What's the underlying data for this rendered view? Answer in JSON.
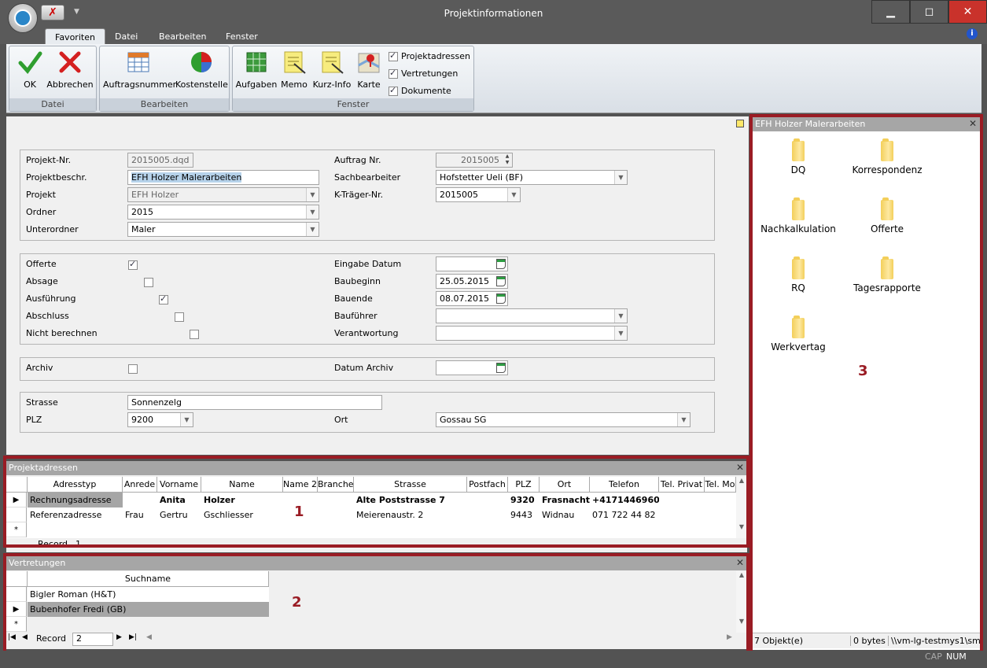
{
  "window": {
    "title": "Projektinformationen",
    "minimize": "▁",
    "maximize": "◻",
    "close": "✕"
  },
  "qat": {
    "cancel_glyph": "✗",
    "dropdown_glyph": "▼"
  },
  "ribbon": {
    "tabs": [
      "Favoriten",
      "Datei",
      "Bearbeiten",
      "Fenster"
    ],
    "active_tab": "Favoriten",
    "groups": {
      "datei": {
        "label": "Datei",
        "ok": "OK",
        "abbrechen": "Abbrechen"
      },
      "bearbeiten": {
        "label": "Bearbeiten",
        "auftragsnummer": "Auftragsnummer",
        "kostenstelle": "Kostenstelle"
      },
      "fenster": {
        "label": "Fenster",
        "aufgaben": "Aufgaben",
        "memo": "Memo",
        "kurzinfo": "Kurz-Info",
        "karte": "Karte",
        "checks": [
          {
            "label": "Projektadressen",
            "checked": true
          },
          {
            "label": "Vertretungen",
            "checked": true
          },
          {
            "label": "Dokumente",
            "checked": true
          }
        ]
      }
    }
  },
  "form": {
    "projekt_nr": {
      "label": "Projekt-Nr.",
      "value": "2015005.dqd"
    },
    "projektbeschr": {
      "label": "Projektbeschr.",
      "value": "EFH Holzer Malerarbeiten"
    },
    "projekt": {
      "label": "Projekt",
      "value": "EFH Holzer"
    },
    "ordner": {
      "label": "Ordner",
      "value": "2015"
    },
    "unterordner": {
      "label": "Unterordner",
      "value": "Maler"
    },
    "auftrag_nr": {
      "label": "Auftrag Nr.",
      "value": "2015005"
    },
    "sachbearbeiter": {
      "label": "Sachbearbeiter",
      "value": "Hofstetter Ueli (BF)"
    },
    "ktraeger": {
      "label": "K-Träger-Nr.",
      "value": "2015005"
    },
    "offerte": {
      "label": "Offerte",
      "checked": true
    },
    "absage": {
      "label": "Absage",
      "checked": false
    },
    "ausfuehrung": {
      "label": "Ausführung",
      "checked": true
    },
    "abschluss": {
      "label": "Abschluss",
      "checked": false
    },
    "nicht_berechnen": {
      "label": "Nicht berechnen",
      "checked": false
    },
    "eingabe_datum": {
      "label": "Eingabe Datum",
      "value": ""
    },
    "baubeginn": {
      "label": "Baubeginn",
      "value": "25.05.2015"
    },
    "bauende": {
      "label": "Bauende",
      "value": "08.07.2015"
    },
    "baufuehrer": {
      "label": "Bauführer",
      "value": ""
    },
    "verantwortung": {
      "label": "Verantwortung",
      "value": ""
    },
    "archiv": {
      "label": "Archiv",
      "checked": false
    },
    "datum_archiv": {
      "label": "Datum Archiv",
      "value": ""
    },
    "strasse": {
      "label": "Strasse",
      "value": "Sonnenzelg"
    },
    "plz": {
      "label": "PLZ",
      "value": "9200"
    },
    "ort": {
      "label": "Ort",
      "value": "Gossau SG"
    }
  },
  "projektadressen": {
    "title": "Projektadressen",
    "columns": [
      "Adresstyp",
      "Anrede",
      "Vorname",
      "Name",
      "Name 2",
      "Branche",
      "Strasse",
      "Postfach",
      "PLZ",
      "Ort",
      "Telefon",
      "Tel. Privat",
      "Tel. Mo"
    ],
    "rows": [
      {
        "adresstyp": "Rechnungsadresse",
        "anrede": "",
        "vorname": "Anita",
        "name": "Holzer",
        "name2": "",
        "branche": "",
        "strasse": "Alte Poststrasse 7",
        "postfach": "",
        "plz": "9320",
        "ort": "Frasnacht",
        "telefon": "+4171446960"
      },
      {
        "adresstyp": "Referenzadresse",
        "anrede": "Frau",
        "vorname": "Gertru",
        "name": "Gschliesser",
        "name2": "",
        "branche": "",
        "strasse": "Meierenaustr. 2",
        "postfach": "",
        "plz": "9443",
        "ort": "Widnau",
        "telefon": "071 722 44 82"
      }
    ],
    "new_row_marker": "*",
    "record_label": "Record",
    "record_value": "1",
    "annotation": "1"
  },
  "vertretungen": {
    "title": "Vertretungen",
    "column": "Suchname",
    "rows": [
      "Bigler Roman (H&T)",
      "Bubenhofer Fredi (GB)"
    ],
    "new_row_marker": "*",
    "record_label": "Record",
    "record_value": "2",
    "annotation": "2"
  },
  "dokumente": {
    "title": "EFH Holzer Malerarbeiten",
    "folders": [
      "DQ",
      "Korrespondenz",
      "Nachkalkulation",
      "Offerte",
      "RQ",
      "Tagesrapporte",
      "Werkvertag"
    ],
    "annotation": "3",
    "status": {
      "count": "7 Objekt(e)",
      "size": "0 bytes",
      "path": "\\\\vm-lg-testmys1\\sm"
    }
  },
  "statusbar": {
    "cap": "CAP",
    "num": "NUM"
  },
  "colors": {
    "annotation_red": "#9a1c24",
    "title_bar": "#5a5a5a",
    "pane_title": "#a6a6a6"
  }
}
